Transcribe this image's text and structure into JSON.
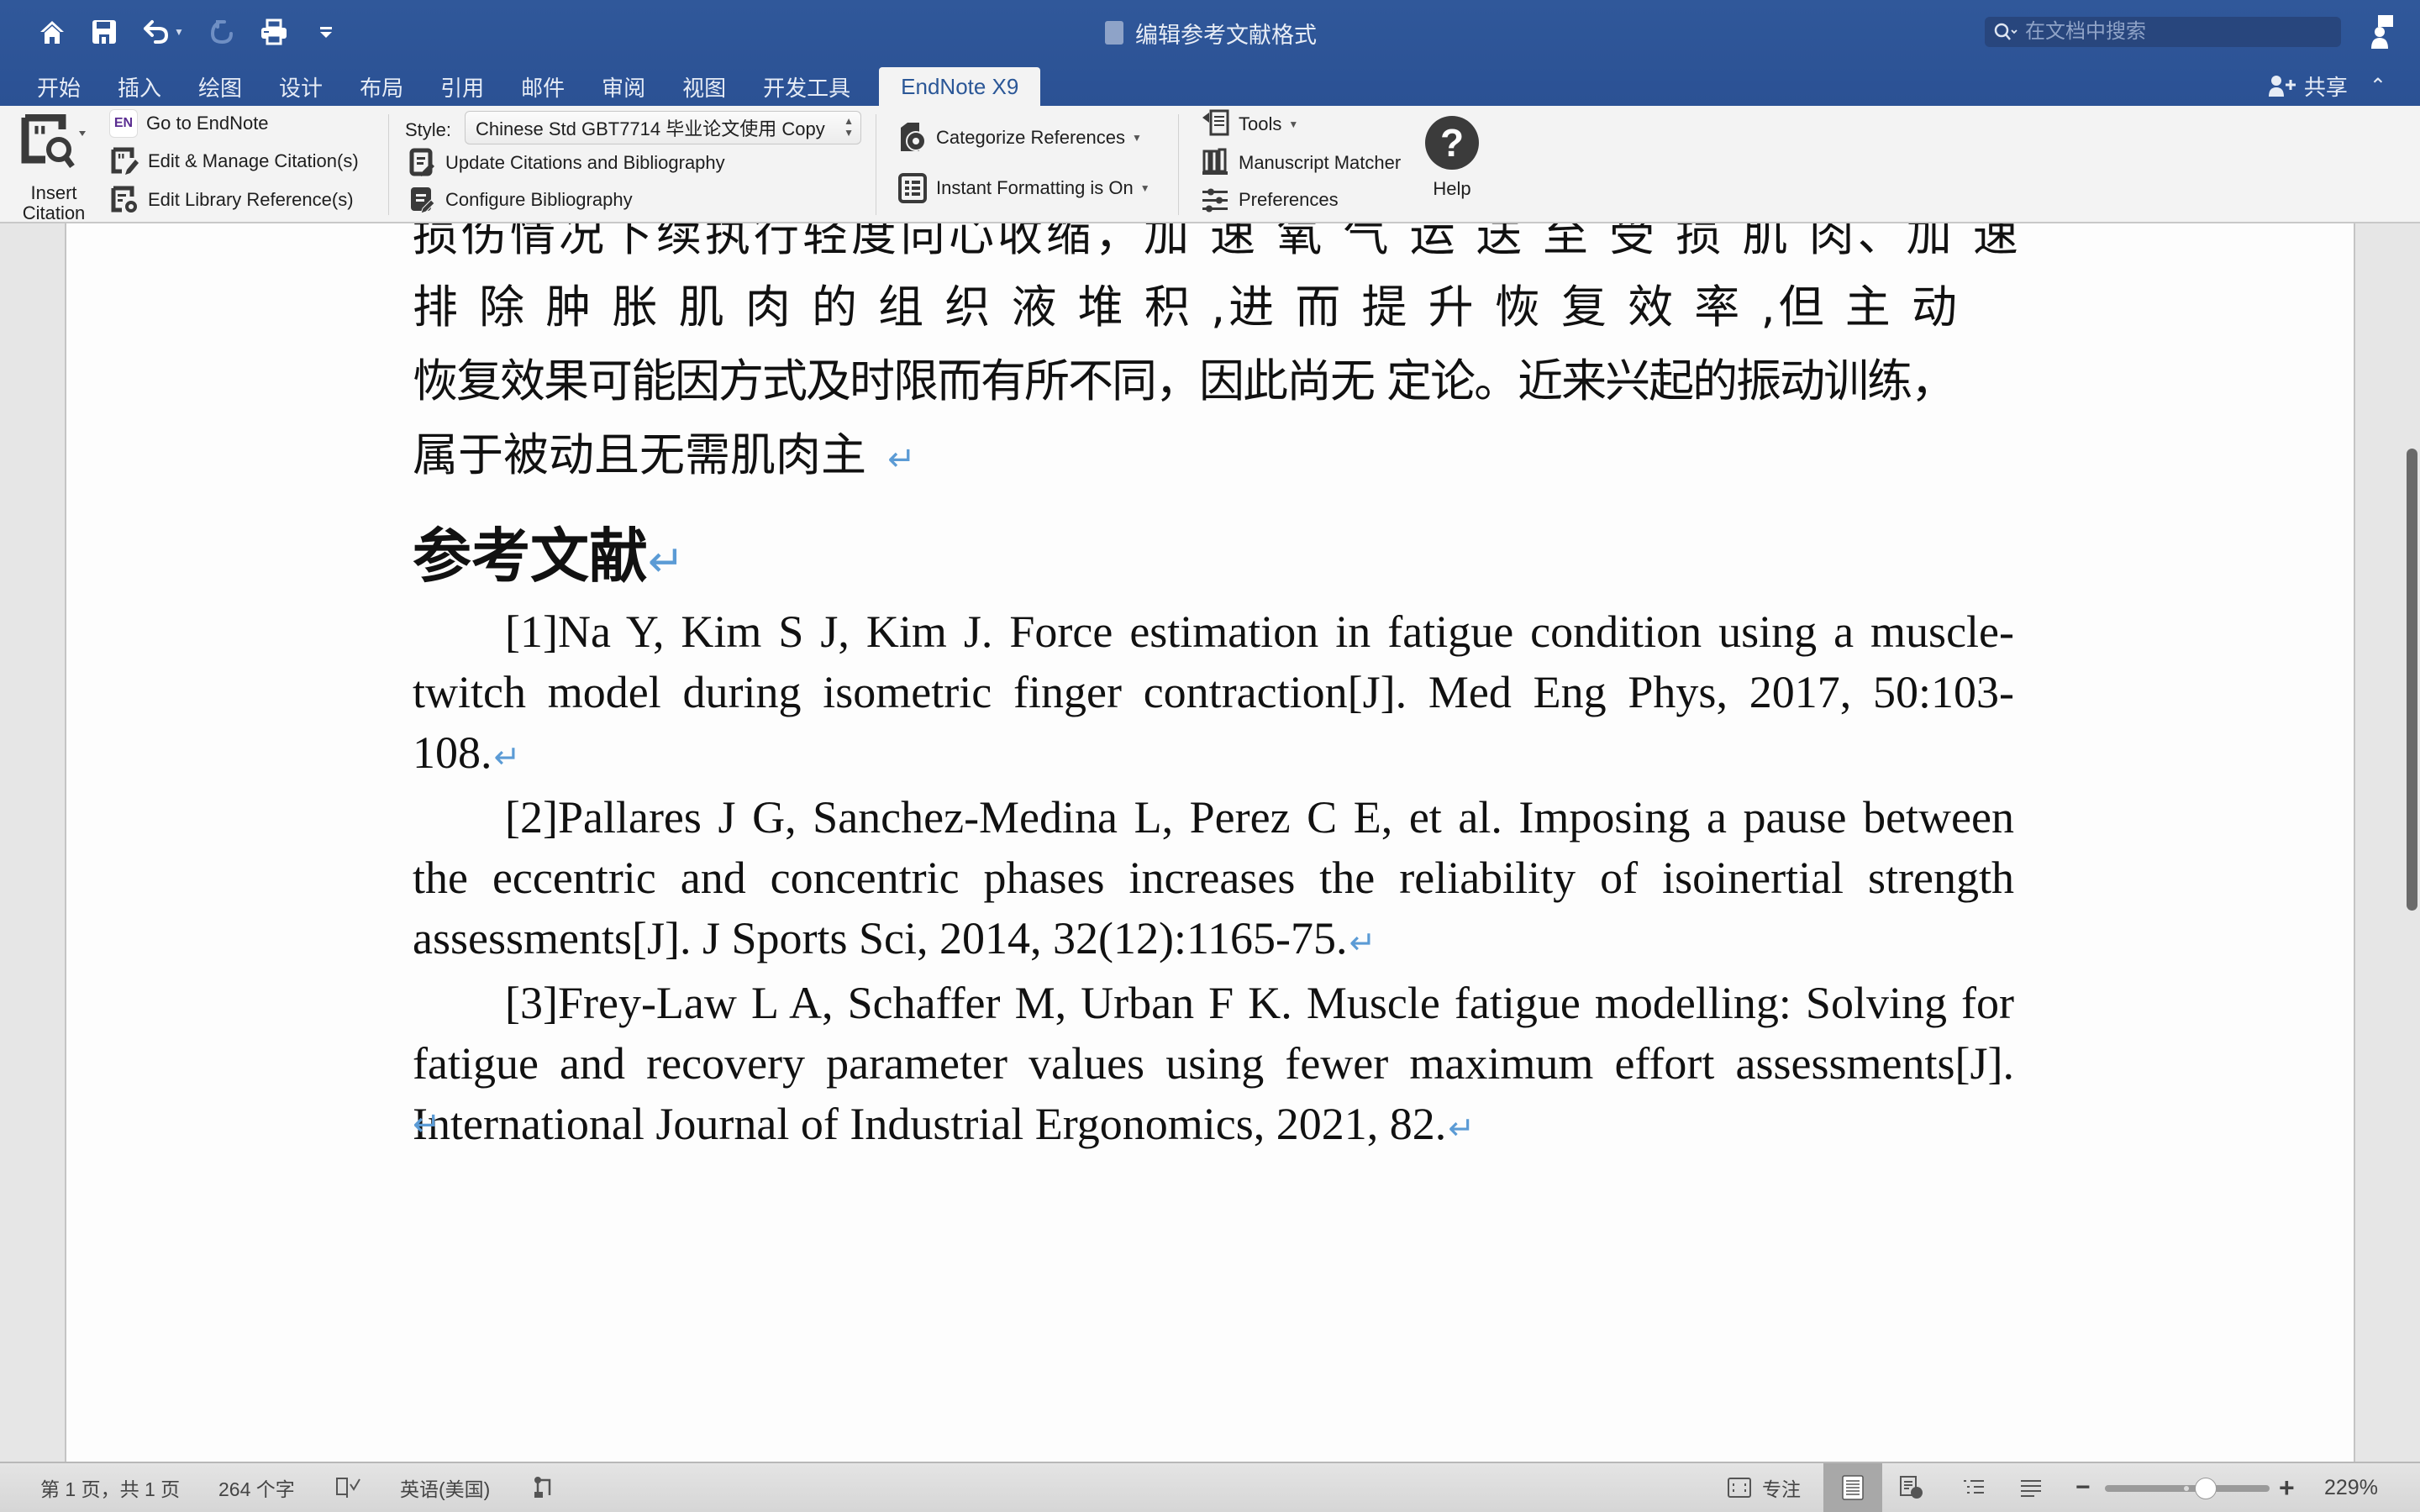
{
  "window": {
    "title": "编辑参考文献格式",
    "search_placeholder": "在文档中搜索"
  },
  "quick_access": [
    {
      "name": "home-icon"
    },
    {
      "name": "save-icon"
    },
    {
      "name": "undo-icon"
    },
    {
      "name": "redo-icon"
    },
    {
      "name": "print-icon"
    },
    {
      "name": "customize-toolbar-icon"
    }
  ],
  "tabs": [
    {
      "label": "开始"
    },
    {
      "label": "插入"
    },
    {
      "label": "绘图"
    },
    {
      "label": "设计"
    },
    {
      "label": "布局"
    },
    {
      "label": "引用"
    },
    {
      "label": "邮件"
    },
    {
      "label": "审阅"
    },
    {
      "label": "视图"
    },
    {
      "label": "开发工具"
    },
    {
      "label": "EndNote X9",
      "active": true
    }
  ],
  "share_label": "共享",
  "ribbon": {
    "insert_citation_line1": "Insert",
    "insert_citation_line2": "Citation",
    "go_to_endnote": "Go to EndNote",
    "edit_manage_citations": "Edit & Manage Citation(s)",
    "edit_library_references": "Edit Library Reference(s)",
    "style_label": "Style:",
    "style_value": "Chinese Std GBT7714 毕业论文使用 Copy",
    "update_citations": "Update Citations and Bibliography",
    "configure_bibliography": "Configure Bibliography",
    "categorize_references": "Categorize References",
    "instant_formatting": "Instant Formatting is On",
    "tools": "Tools",
    "manuscript_matcher": "Manuscript Matcher",
    "preferences": "Preferences",
    "help": "Help",
    "en_badge": "EN",
    "help_glyph": "?"
  },
  "document": {
    "body_lines": [
      "损伤情况下续执行轻度向心收缩，加 速 氧 气 运 送 至 受 损 肌 肉、加 速",
      "排 除 肿 胀 肌 肉 的 组 织 液 堆 积 ,进 而 提 升 恢 复 效 率 ,但 主 动",
      "恢复效果可能因方式及时限而有所不同，因此尚无  定论。近来兴起的振动训练，",
      "属于被动且无需肌肉主 "
    ],
    "heading": "参考文献",
    "references": [
      "[1]Na Y, Kim S J, Kim J. Force estimation in fatigue condition using a muscle-twitch model during isometric finger contraction[J]. Med Eng Phys, 2017, 50:103-108.",
      "[2]Pallares J G, Sanchez-Medina L, Perez C E, et al. Imposing a pause between the eccentric and concentric phases increases the reliability of isoinertial strength assessments[J]. J Sports Sci, 2014, 32(12):1165-75.",
      "[3]Frey-Law L A, Schaffer M, Urban F K. Muscle fatigue modelling: Solving for fatigue and recovery parameter values using fewer maximum effort assessments[J]. International Journal of Industrial Ergonomics, 2021, 82."
    ],
    "paragraph_mark": "↵"
  },
  "statusbar": {
    "page_info": "第 1 页，共 1 页",
    "word_count": "264 个字",
    "language": "英语(美国)",
    "focus_label": "专注",
    "zoom_level": "229%",
    "zoom_minus": "−",
    "zoom_plus": "+"
  },
  "colors": {
    "titlebar": "#2e5596",
    "active_tab_text": "#2b5797",
    "paragraph_mark": "#5b9bd5"
  }
}
